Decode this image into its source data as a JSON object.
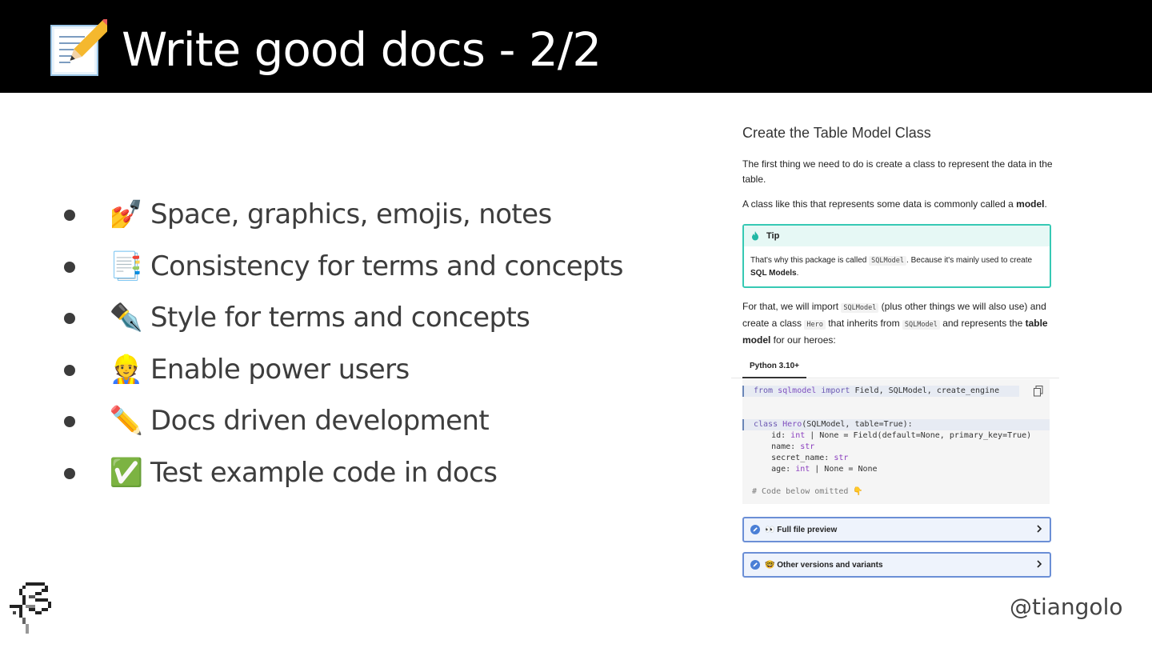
{
  "slide": {
    "title": "Write good docs - 2/2",
    "title_icon": "memo-pencil-icon",
    "handle": "@tiangolo",
    "logo_icon": "pixel-logo-icon"
  },
  "bullets": [
    {
      "emoji": "💅",
      "text": "Space, graphics, emojis, notes"
    },
    {
      "emoji": "📑",
      "text": "Consistency for terms and concepts"
    },
    {
      "emoji": "✒️",
      "text": "Style for terms and concepts"
    },
    {
      "emoji": "👷",
      "text": "Enable power users"
    },
    {
      "emoji": "✏️",
      "text": "Docs driven development"
    },
    {
      "emoji": "✅",
      "text": "Test example code in docs"
    }
  ],
  "doc": {
    "heading": "Create the Table Model Class",
    "para1": "The first thing we need to do is create a class to represent the data in the table.",
    "para2_pre": "A class like this that represents some data is commonly called a ",
    "para2_bold": "model",
    "para2_post": ".",
    "tip": {
      "label": "Tip",
      "pre": "That's why this package is called ",
      "code": "SQLModel",
      "mid": ". Because it's mainly used to create ",
      "bold": "SQL Models",
      "post": "."
    },
    "para3": {
      "a": "For that, we will import ",
      "c1": "SQLModel",
      "b": " (plus other things we will also use) and create a class ",
      "c2": "Hero",
      "c": " that inherits from ",
      "c3": "SQLModel",
      "d": " and represents the ",
      "bold": "table model",
      "e": " for our heroes:"
    },
    "tab_label": "Python 3.10+",
    "code": {
      "l1_kw1": "from",
      "l1_mod": "sqlmodel",
      "l1_kw2": "import",
      "l1_rest": " Field, SQLModel, create_engine",
      "l2_kw": "class",
      "l2_name": "Hero",
      "l2_rest": "(SQLModel, table=True):",
      "l3a": "    id: ",
      "l3t": "int",
      "l3b": " | None = Field(default=None, primary_key=True)",
      "l4a": "    name: ",
      "l4t": "str",
      "l5a": "    secret_name: ",
      "l5t": "str",
      "l6a": "    age: ",
      "l6t": "int",
      "l6b": " | None = None",
      "comment": "# Code below omitted 👇"
    },
    "full_file": "👀 Full file preview",
    "other_versions": "🤓 Other versions and variants"
  }
}
